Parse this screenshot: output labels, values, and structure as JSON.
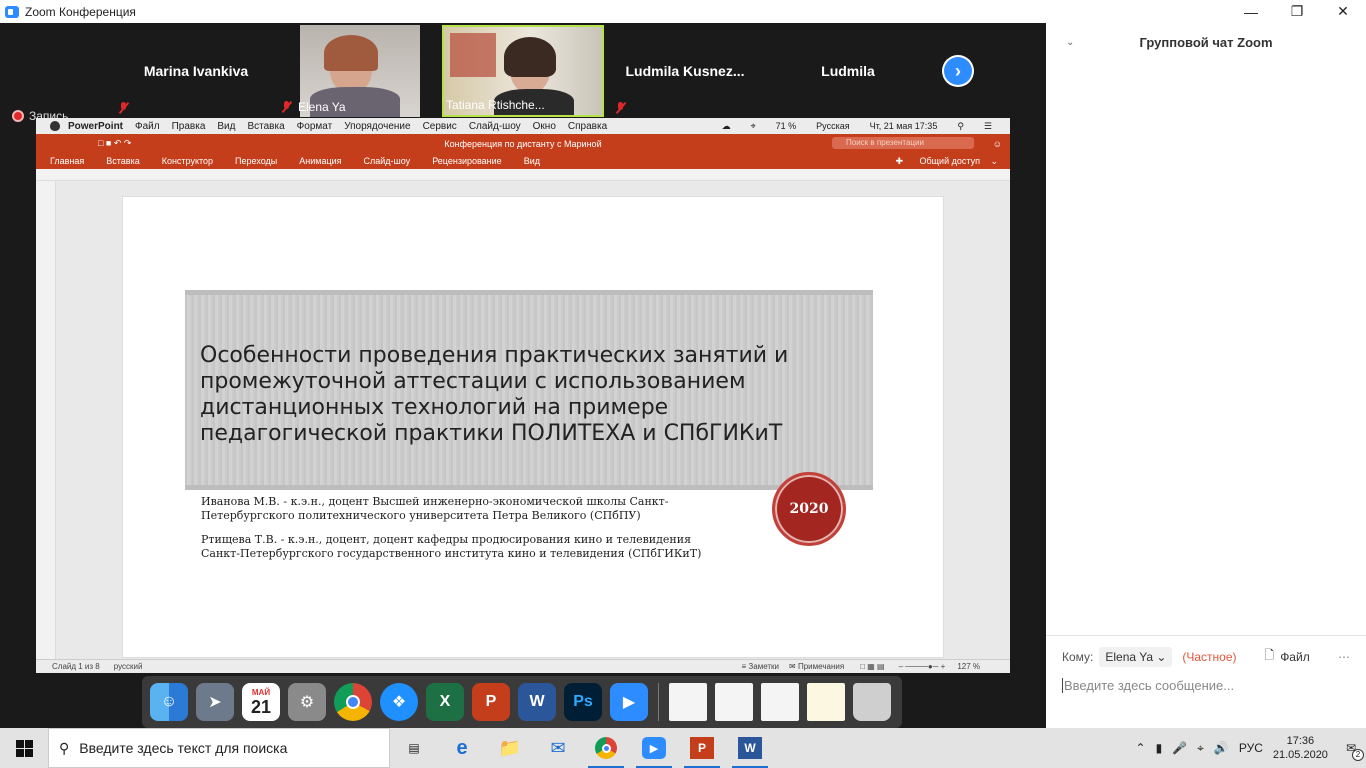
{
  "window": {
    "title": "Zoom Конференция"
  },
  "participants": [
    {
      "name": "Marina Ivankiva",
      "label": "",
      "video": false,
      "muted": true
    },
    {
      "name": "",
      "label": "Elena Ya",
      "video": true,
      "muted": true
    },
    {
      "name": "",
      "label": "Tatiana Rtishche...",
      "video": true,
      "muted": false,
      "active": true
    },
    {
      "name": "Ludmila  Kusnez...",
      "label": "",
      "video": false,
      "muted": true
    },
    {
      "name": "Ludmila",
      "label": "",
      "video": false,
      "muted": false
    }
  ],
  "recording": {
    "label": "Запись"
  },
  "mac_menu": {
    "app": "PowerPoint",
    "items": [
      "Файл",
      "Правка",
      "Вид",
      "Вставка",
      "Формат",
      "Упорядочение",
      "Сервис",
      "Слайд-шоу",
      "Окно",
      "Справка"
    ],
    "battery": "71 %",
    "language": "Русская",
    "datetime": "Чт, 21 мая  17:35"
  },
  "ppt": {
    "doc_title": "Конференция по дистанту с Мариной",
    "search_placeholder": "Поиск в презентации",
    "tabs": [
      "Главная",
      "Вставка",
      "Конструктор",
      "Переходы",
      "Анимация",
      "Слайд-шоу",
      "Рецензирование",
      "Вид"
    ],
    "share": "Общий доступ",
    "status_left": "Слайд 1 из 8",
    "status_lang": "русский",
    "notes": "Заметки",
    "comments": "Примечания",
    "zoom": "127 %"
  },
  "slide": {
    "title": "Особенности проведения практических занятий и промежуточной аттестации с использованием дистанционных технологий на примере педагогической практики ПОЛИТЕХА и СПбГИКиТ",
    "seal": "2020",
    "author1_line1": "Иванова М.В. - к.э.н., доцент Высшей инженерно-экономической школы Санкт-",
    "author1_line2": "Петербургского политехнического университета Петра Великого (СПбПУ)",
    "author2_line1": "Ртищева Т.В. - к.э.н., доцент, доцент кафедры продюсирования кино и телевидения",
    "author2_line2": "Санкт-Петербургского государственного института кино и телевидения (СПбГИКиТ)"
  },
  "dock": {
    "calendar_month": "МАЙ",
    "calendar_day": "21"
  },
  "chat": {
    "header": "Групповой чат Zoom",
    "to_label": "Кому:",
    "to_value": "Elena Ya",
    "private": "(Частное)",
    "file": "Файл",
    "placeholder": "Введите здесь сообщение..."
  },
  "taskbar": {
    "search_placeholder": "Введите здесь текст для поиска",
    "lang": "РУС",
    "time": "17:36",
    "date": "21.05.2020",
    "notifications": "2"
  }
}
